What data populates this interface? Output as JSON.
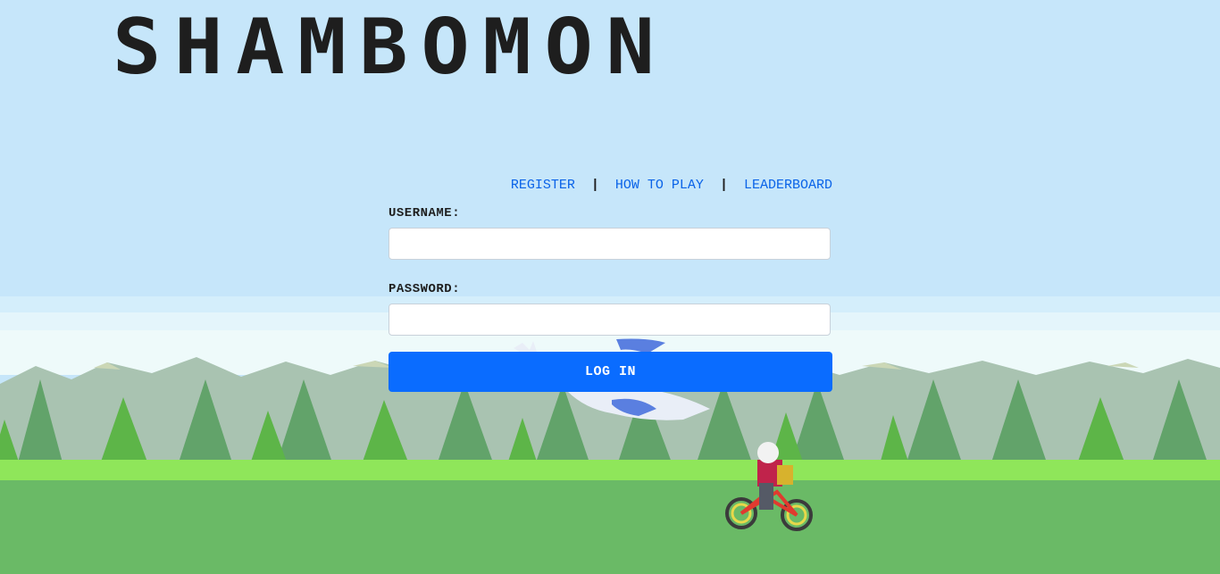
{
  "app": {
    "title": "SHAMBOMON"
  },
  "nav": {
    "register": "REGISTER",
    "how_to_play": "HOW TO PLAY",
    "leaderboard": "LEADERBOARD",
    "separator": "|"
  },
  "form": {
    "username_label": "USERNAME:",
    "username_value": "",
    "password_label": "PASSWORD:",
    "password_value": "",
    "login_label": "LOG IN"
  },
  "colors": {
    "sky": "#c6e6fa",
    "link": "#0a63e8",
    "button": "#0a6cff",
    "grass": "#6aba66"
  }
}
